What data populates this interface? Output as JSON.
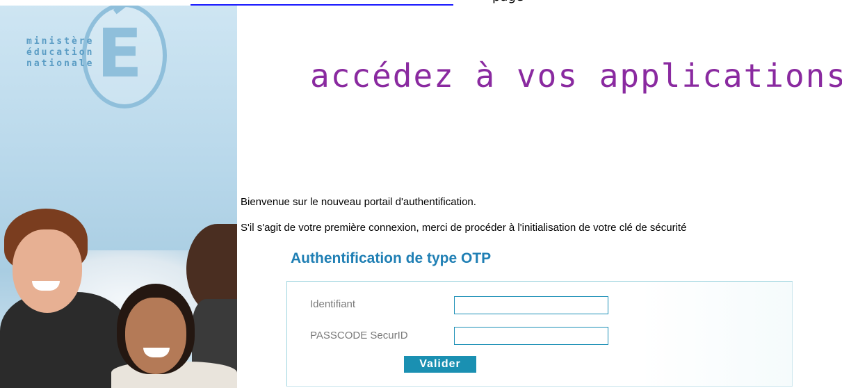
{
  "top_bar": {
    "link_text": "",
    "trailing_text": "page"
  },
  "logo": {
    "lines": [
      "ministère",
      "éducation",
      "nationale"
    ],
    "letter": "E"
  },
  "header": {
    "title": "accédez à vos applications"
  },
  "main": {
    "welcome_text": "Bienvenue sur le nouveau portail d'authentification.",
    "first_connection_text": "S'il s'agit de votre première connexion, merci de procéder à l'initialisation de votre clé de sécurité"
  },
  "form": {
    "title": "Authentification de type OTP",
    "username_label": "Identifiant",
    "username_value": "",
    "passcode_label": "PASSCODE SecurID",
    "passcode_value": "",
    "submit_label": "Valider"
  },
  "colors": {
    "headline": "#8a2aa0",
    "form_title": "#1f7fb4",
    "button": "#1a90b2",
    "input_border": "#1b8fb6",
    "link": "#1a1aff"
  }
}
